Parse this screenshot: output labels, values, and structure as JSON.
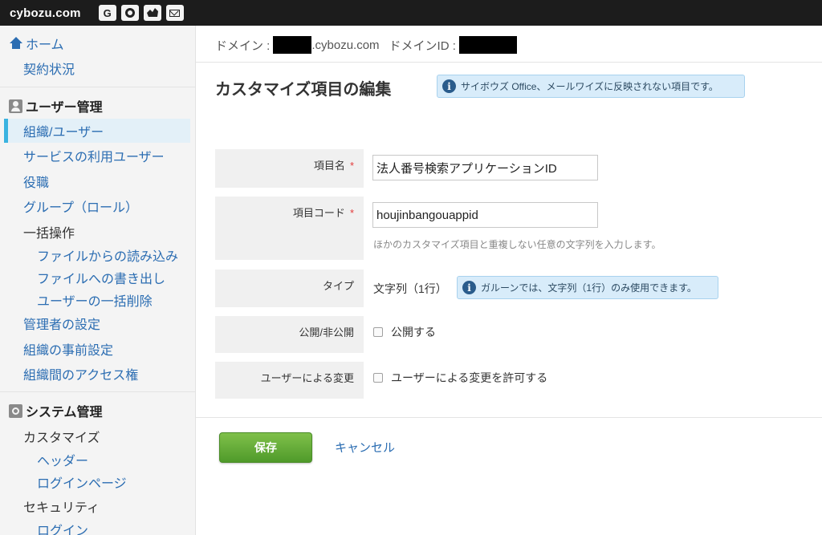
{
  "header": {
    "logo": "cybozu.com",
    "icons": [
      "garoon-icon",
      "office-icon",
      "mailwise-icon",
      "mail-icon"
    ],
    "icon_g_label": "G"
  },
  "sidebar": {
    "home": "ホーム",
    "contract": "契約状況",
    "user_section": "ユーザー管理",
    "org_users": "組織/ユーザー",
    "service_users": "サービスの利用ユーザー",
    "roles": "役職",
    "groups": "グループ（ロール）",
    "bulk": "一括操作",
    "file_import": "ファイルからの読み込み",
    "file_export": "ファイルへの書き出し",
    "bulk_delete": "ユーザーの一括削除",
    "admin_settings": "管理者の設定",
    "org_presets": "組織の事前設定",
    "inter_org_access": "組織間のアクセス権",
    "system_section": "システム管理",
    "customize": "カスタマイズ",
    "header_item": "ヘッダー",
    "login_page": "ログインページ",
    "security": "セキュリティ",
    "login": "ログイン"
  },
  "main": {
    "domain_label": "ドメイン :",
    "domain_suffix": ".cybozu.com",
    "domain_id_label": "ドメインID :",
    "title": "カスタマイズ項目の編集",
    "title_info": "サイボウズ Office、メールワイズに反映されない項目です。",
    "form": {
      "item_name_label": "項目名",
      "item_name_value": "法人番号検索アプリケーションID",
      "item_code_label": "項目コード",
      "item_code_value": "houjinbangouappid",
      "item_code_hint": "ほかのカスタマイズ項目と重複しない任意の文字列を入力します。",
      "type_label": "タイプ",
      "type_value": "文字列（1行）",
      "type_info": "ガルーンでは、文字列（1行）のみ使用できます。",
      "visibility_label": "公開/非公開",
      "visibility_checkbox": "公開する",
      "user_change_label": "ユーザーによる変更",
      "user_change_checkbox": "ユーザーによる変更を許可する",
      "required_mark": "*"
    },
    "save_label": "保存",
    "cancel_label": "キャンセル"
  },
  "colors": {
    "accent": "#2b6db2",
    "active_bar": "#3ab3e0",
    "save_green": "#5aa832",
    "required": "#e33a3a"
  }
}
